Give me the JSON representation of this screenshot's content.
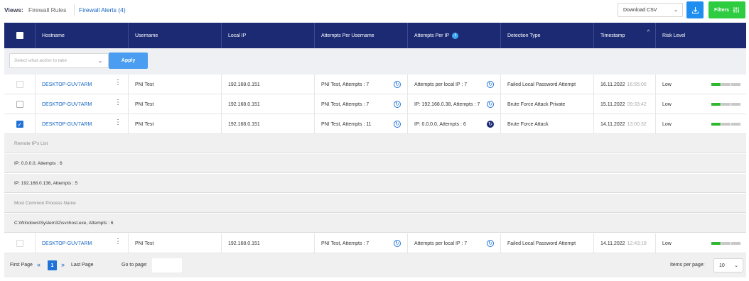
{
  "views": {
    "label": "Views:",
    "items": [
      {
        "label": "Firewall Rules",
        "active": false
      },
      {
        "label": "Firewall Alerts (4)",
        "active": true
      }
    ]
  },
  "toolbar": {
    "download_select": "Download CSV",
    "download_icon": "download-icon",
    "filters_label": "Filters",
    "filters_icon": "sliders-icon",
    "colors": {
      "primary": "#1f8ef1",
      "filters": "#2ecc40",
      "header": "#1b2a73"
    }
  },
  "table": {
    "columns": [
      {
        "label": ""
      },
      {
        "label": "Hostname"
      },
      {
        "label": "Username"
      },
      {
        "label": "Local IP"
      },
      {
        "label": "Attempts Per Username"
      },
      {
        "label": "Attempts Per IP"
      },
      {
        "label": "Detection Type"
      },
      {
        "label": "Timestamp"
      },
      {
        "label": "Risk Level"
      }
    ],
    "attempts_per_ip_info": "i",
    "timestamp_sort": "^",
    "action": {
      "placeholder": "Select what action to take",
      "apply_label": "Apply"
    },
    "rows": [
      {
        "checked": false,
        "checkbox_faded": true,
        "hostname": "DESKTOP-GUV7ARM",
        "username": "PNI Test",
        "local_ip": "192.168.0.151",
        "attempts_per_username": "PNI Test, Attempts : 7",
        "attempts_per_ip": "Attempts per local IP : 7",
        "detection_type": "Failed Local Password Attempt",
        "date": "16.11.2022",
        "time": "16:55:05",
        "risk": "Low",
        "risk_level": 1
      },
      {
        "checked": false,
        "checkbox_faded": false,
        "hostname": "DESKTOP-GUV7ARM",
        "username": "PNI Test",
        "local_ip": "192.168.0.151",
        "attempts_per_username": "PNI Test, Attempts : 7",
        "attempts_per_ip": "IP: 192.168.0.38, Attempts : 7",
        "detection_type": "Brute Force Attack Private",
        "date": "15.11.2022",
        "time": "09:33:42",
        "risk": "Low",
        "risk_level": 1
      },
      {
        "checked": true,
        "checkbox_faded": false,
        "hostname": "DESKTOP-GUV7ARM",
        "username": "PNI Test",
        "local_ip": "192.168.0.151",
        "attempts_per_username": "PNI Test, Attempts : 11",
        "attempts_per_ip": "IP: 0.0.0.0, Attempts : 6",
        "detection_type": "Brute Force Attack",
        "date": "14.11.2022",
        "time": "13:00:32",
        "risk": "Low",
        "risk_level": 1
      }
    ],
    "expanded": {
      "remote_heading": "Remote IP's List",
      "remote_items": [
        "IP: 0.0.0.0, Attempts : 6",
        "IP: 192.168.0.136, Attempts : 5"
      ],
      "process_heading": "Most Common Process Name",
      "process_items": [
        "C:\\Windows\\System32\\svchost.exe, Attempts : 6"
      ]
    },
    "last_row": {
      "checked": false,
      "checkbox_faded": true,
      "hostname": "DESKTOP-GUV7ARM",
      "username": "PNI Test",
      "local_ip": "192.168.0.151",
      "attempts_per_username": "PNI Test, Attempts : 7",
      "attempts_per_ip": "Attempts per local IP : 7",
      "detection_type": "Failed Local Password Attempt",
      "date": "14.11.2022",
      "time": "12:43:18",
      "risk": "Low",
      "risk_level": 1
    }
  },
  "pagination": {
    "first_label": "First Page",
    "prev_symbol": "«",
    "current_page": "1",
    "next_symbol": "»",
    "last_label": "Last Page",
    "goto_label": "Go to page:",
    "goto_value": "",
    "items_per_page_label": "Items per page:",
    "items_per_page": "10"
  }
}
